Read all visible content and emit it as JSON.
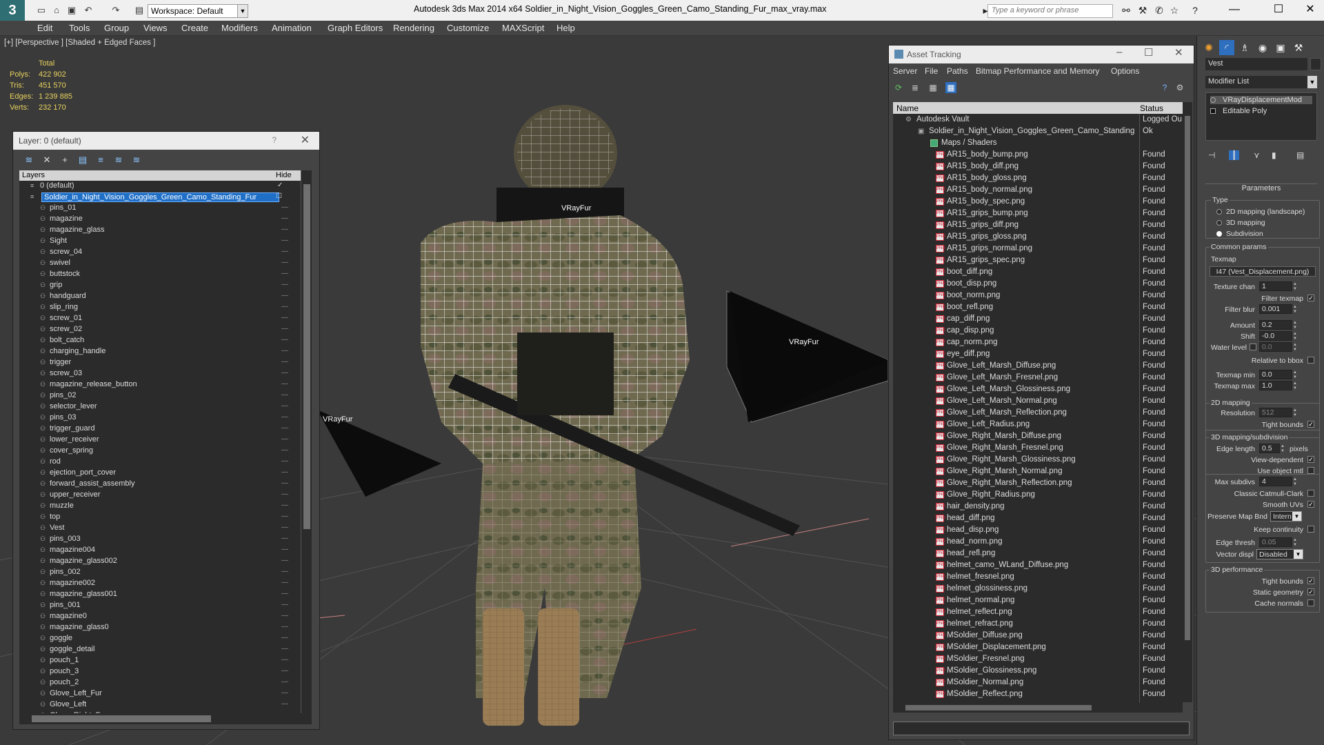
{
  "titlebar": {
    "logo": "3",
    "workspace": "Workspace: Default",
    "title": "Autodesk 3ds Max 2014 x64      Soldier_in_Night_Vision_Goggles_Green_Camo_Standing_Fur_max_vray.max",
    "search_placeholder": "Type a keyword or phrase"
  },
  "menus": [
    "Edit",
    "Tools",
    "Group",
    "Views",
    "Create",
    "Modifiers",
    "Animation",
    "Graph Editors",
    "Rendering",
    "Customize",
    "MAXScript",
    "Help"
  ],
  "viewport": {
    "label": "[+] [Perspective ] [Shaded + Edged Faces ]",
    "stats": {
      "total_label": "Total",
      "rows": [
        {
          "label": "Polys:",
          "value": "422 902"
        },
        {
          "label": "Tris:",
          "value": "451 570"
        },
        {
          "label": "Edges:",
          "value": "1 239 885"
        },
        {
          "label": "Verts:",
          "value": "232 170"
        }
      ]
    },
    "fur_labels": [
      "VRayFur",
      "VRayFur",
      "VRayFur"
    ]
  },
  "layer_panel": {
    "title": "Layer: 0 (default)",
    "help": "?",
    "close": "✕",
    "col_layers": "Layers",
    "col_hide": "Hide",
    "layers": [
      {
        "name": "0 (default)",
        "level": 0,
        "check": "✓"
      },
      {
        "name": "Soldier_in_Night_Vision_Goggles_Green_Camo_Standing_Fur",
        "level": 0,
        "selected": true
      },
      {
        "name": "pins_01",
        "level": 1
      },
      {
        "name": "magazine",
        "level": 1
      },
      {
        "name": "magazine_glass",
        "level": 1
      },
      {
        "name": "Sight",
        "level": 1
      },
      {
        "name": "screw_04",
        "level": 1
      },
      {
        "name": "swivel",
        "level": 1
      },
      {
        "name": "buttstock",
        "level": 1
      },
      {
        "name": "grip",
        "level": 1
      },
      {
        "name": "handguard",
        "level": 1
      },
      {
        "name": "slip_ring",
        "level": 1
      },
      {
        "name": "screw_01",
        "level": 1
      },
      {
        "name": "screw_02",
        "level": 1
      },
      {
        "name": "bolt_catch",
        "level": 1
      },
      {
        "name": "charging_handle",
        "level": 1
      },
      {
        "name": "trigger",
        "level": 1
      },
      {
        "name": "screw_03",
        "level": 1
      },
      {
        "name": "magazine_release_button",
        "level": 1
      },
      {
        "name": "pins_02",
        "level": 1
      },
      {
        "name": "selector_lever",
        "level": 1
      },
      {
        "name": "pins_03",
        "level": 1
      },
      {
        "name": "trigger_guard",
        "level": 1
      },
      {
        "name": "lower_receiver",
        "level": 1
      },
      {
        "name": "cover_spring",
        "level": 1
      },
      {
        "name": "rod",
        "level": 1
      },
      {
        "name": "ejection_port_cover",
        "level": 1
      },
      {
        "name": "forward_assist_assembly",
        "level": 1
      },
      {
        "name": "upper_receiver",
        "level": 1
      },
      {
        "name": "muzzle",
        "level": 1
      },
      {
        "name": "top",
        "level": 1
      },
      {
        "name": "Vest",
        "level": 1
      },
      {
        "name": "pins_003",
        "level": 1
      },
      {
        "name": "magazine004",
        "level": 1
      },
      {
        "name": "magazine_glass002",
        "level": 1
      },
      {
        "name": "pins_002",
        "level": 1
      },
      {
        "name": "magazine002",
        "level": 1
      },
      {
        "name": "magazine_glass001",
        "level": 1
      },
      {
        "name": "pins_001",
        "level": 1
      },
      {
        "name": "magazine0",
        "level": 1
      },
      {
        "name": "magazine_glass0",
        "level": 1
      },
      {
        "name": "goggle",
        "level": 1
      },
      {
        "name": "goggle_detail",
        "level": 1
      },
      {
        "name": "pouch_1",
        "level": 1
      },
      {
        "name": "pouch_3",
        "level": 1
      },
      {
        "name": "pouch_2",
        "level": 1
      },
      {
        "name": "Glove_Left_Fur",
        "level": 1
      },
      {
        "name": "Glove_Left",
        "level": 1
      },
      {
        "name": "Glove_Right_Fur",
        "level": 1
      }
    ]
  },
  "asset_panel": {
    "title": "Asset Tracking",
    "menus": [
      "Server",
      "File",
      "Paths",
      "Bitmap Performance and Memory",
      "Options"
    ],
    "col_name": "Name",
    "col_status": "Status",
    "rows": [
      {
        "name": "Autodesk Vault",
        "status": "Logged Ou",
        "type": "vault",
        "level": 0
      },
      {
        "name": "Soldier_in_Night_Vision_Goggles_Green_Camo_Standing_Fur_max_vray.max",
        "status": "Ok",
        "type": "file",
        "level": 1
      },
      {
        "name": "Maps / Shaders",
        "status": "",
        "type": "folder",
        "level": 2
      },
      {
        "name": "AR15_body_bump.png",
        "status": "Found",
        "type": "png",
        "level": 3
      },
      {
        "name": "AR15_body_diff.png",
        "status": "Found",
        "type": "png",
        "level": 3
      },
      {
        "name": "AR15_body_gloss.png",
        "status": "Found",
        "type": "png",
        "level": 3
      },
      {
        "name": "AR15_body_normal.png",
        "status": "Found",
        "type": "png",
        "level": 3
      },
      {
        "name": "AR15_body_spec.png",
        "status": "Found",
        "type": "png",
        "level": 3
      },
      {
        "name": "AR15_grips_bump.png",
        "status": "Found",
        "type": "png",
        "level": 3
      },
      {
        "name": "AR15_grips_diff.png",
        "status": "Found",
        "type": "png",
        "level": 3
      },
      {
        "name": "AR15_grips_gloss.png",
        "status": "Found",
        "type": "png",
        "level": 3
      },
      {
        "name": "AR15_grips_normal.png",
        "status": "Found",
        "type": "png",
        "level": 3
      },
      {
        "name": "AR15_grips_spec.png",
        "status": "Found",
        "type": "png",
        "level": 3
      },
      {
        "name": "boot_diff.png",
        "status": "Found",
        "type": "png",
        "level": 3
      },
      {
        "name": "boot_disp.png",
        "status": "Found",
        "type": "png",
        "level": 3
      },
      {
        "name": "boot_norm.png",
        "status": "Found",
        "type": "png",
        "level": 3
      },
      {
        "name": "boot_refl.png",
        "status": "Found",
        "type": "png",
        "level": 3
      },
      {
        "name": "cap_diff.png",
        "status": "Found",
        "type": "png",
        "level": 3
      },
      {
        "name": "cap_disp.png",
        "status": "Found",
        "type": "png",
        "level": 3
      },
      {
        "name": "cap_norm.png",
        "status": "Found",
        "type": "png",
        "level": 3
      },
      {
        "name": "eye_diff.png",
        "status": "Found",
        "type": "png",
        "level": 3
      },
      {
        "name": "Glove_Left_Marsh_Diffuse.png",
        "status": "Found",
        "type": "png",
        "level": 3
      },
      {
        "name": "Glove_Left_Marsh_Fresnel.png",
        "status": "Found",
        "type": "png",
        "level": 3
      },
      {
        "name": "Glove_Left_Marsh_Glossiness.png",
        "status": "Found",
        "type": "png",
        "level": 3
      },
      {
        "name": "Glove_Left_Marsh_Normal.png",
        "status": "Found",
        "type": "png",
        "level": 3
      },
      {
        "name": "Glove_Left_Marsh_Reflection.png",
        "status": "Found",
        "type": "png",
        "level": 3
      },
      {
        "name": "Glove_Left_Radius.png",
        "status": "Found",
        "type": "png",
        "level": 3
      },
      {
        "name": "Glove_Right_Marsh_Diffuse.png",
        "status": "Found",
        "type": "png",
        "level": 3
      },
      {
        "name": "Glove_Right_Marsh_Fresnel.png",
        "status": "Found",
        "type": "png",
        "level": 3
      },
      {
        "name": "Glove_Right_Marsh_Glossiness.png",
        "status": "Found",
        "type": "png",
        "level": 3
      },
      {
        "name": "Glove_Right_Marsh_Normal.png",
        "status": "Found",
        "type": "png",
        "level": 3
      },
      {
        "name": "Glove_Right_Marsh_Reflection.png",
        "status": "Found",
        "type": "png",
        "level": 3
      },
      {
        "name": "Glove_Right_Radius.png",
        "status": "Found",
        "type": "png",
        "level": 3
      },
      {
        "name": "hair_density.png",
        "status": "Found",
        "type": "png",
        "level": 3
      },
      {
        "name": "head_diff.png",
        "status": "Found",
        "type": "png",
        "level": 3
      },
      {
        "name": "head_disp.png",
        "status": "Found",
        "type": "png",
        "level": 3
      },
      {
        "name": "head_norm.png",
        "status": "Found",
        "type": "png",
        "level": 3
      },
      {
        "name": "head_refl.png",
        "status": "Found",
        "type": "png",
        "level": 3
      },
      {
        "name": "helmet_camo_WLand_Diffuse.png",
        "status": "Found",
        "type": "png",
        "level": 3
      },
      {
        "name": "helmet_fresnel.png",
        "status": "Found",
        "type": "png",
        "level": 3
      },
      {
        "name": "helmet_glossiness.png",
        "status": "Found",
        "type": "png",
        "level": 3
      },
      {
        "name": "helmet_normal.png",
        "status": "Found",
        "type": "png",
        "level": 3
      },
      {
        "name": "helmet_reflect.png",
        "status": "Found",
        "type": "png",
        "level": 3
      },
      {
        "name": "helmet_refract.png",
        "status": "Found",
        "type": "png",
        "level": 3
      },
      {
        "name": "MSoldier_Diffuse.png",
        "status": "Found",
        "type": "png",
        "level": 3
      },
      {
        "name": "MSoldier_Displacement.png",
        "status": "Found",
        "type": "png",
        "level": 3
      },
      {
        "name": "MSoldier_Fresnel.png",
        "status": "Found",
        "type": "png",
        "level": 3
      },
      {
        "name": "MSoldier_Glossiness.png",
        "status": "Found",
        "type": "png",
        "level": 3
      },
      {
        "name": "MSoldier_Normal.png",
        "status": "Found",
        "type": "png",
        "level": 3
      },
      {
        "name": "MSoldier_Reflect.png",
        "status": "Found",
        "type": "png",
        "level": 3
      }
    ]
  },
  "command_panel": {
    "object_name": "Vest",
    "modifier_list": "Modifier List",
    "stack": [
      "VRayDisplacementMod",
      "Editable Poly"
    ],
    "rollout": "Parameters",
    "type_label": "Type",
    "type_options": [
      {
        "label": "2D mapping (landscape)",
        "selected": false
      },
      {
        "label": "3D mapping",
        "selected": false
      },
      {
        "label": "Subdivision",
        "selected": true
      }
    ],
    "common_params": "Common params",
    "texmap_label": "Texmap",
    "texmap_value": "I47 (Vest_Displacement.png)",
    "texture_chan_label": "Texture chan",
    "texture_chan": "1",
    "filter_texmap_label": "Filter texmap",
    "filter_blur_label": "Filter blur",
    "filter_blur": "0.001",
    "amount_label": "Amount",
    "amount": "0.2",
    "shift_label": "Shift",
    "shift": "-0.0",
    "water_level_label": "Water level",
    "water_level": "0.0",
    "relative_bbox_label": "Relative to bbox",
    "texmap_min_label": "Texmap min",
    "texmap_min": "0.0",
    "texmap_max_label": "Texmap max",
    "texmap_max": "1.0",
    "mapping2d": "2D mapping",
    "resolution_label": "Resolution",
    "resolution": "512",
    "tight_bounds_label": "Tight bounds",
    "mapping3d": "3D mapping/subdivision",
    "edge_length_label": "Edge length",
    "edge_length": "0.5",
    "pixels_label": "pixels",
    "view_dependent_label": "View-dependent",
    "use_object_mtl_label": "Use object mtl",
    "max_subdivs_label": "Max subdivs",
    "max_subdivs": "4",
    "classic_cc_label": "Classic Catmull-Clark",
    "smooth_uvs_label": "Smooth UVs",
    "preserve_map_label": "Preserve Map Bnd",
    "preserve_map": "Intern",
    "keep_continuity_label": "Keep continuity",
    "edge_thresh_label": "Edge thresh",
    "edge_thresh": "0.05",
    "vector_displ_label": "Vector displ",
    "vector_displ": "Disabled",
    "perf3d": "3D performance",
    "tight_bounds2_label": "Tight bounds",
    "static_geometry_label": "Static geometry",
    "cache_normals_label": "Cache normals"
  }
}
